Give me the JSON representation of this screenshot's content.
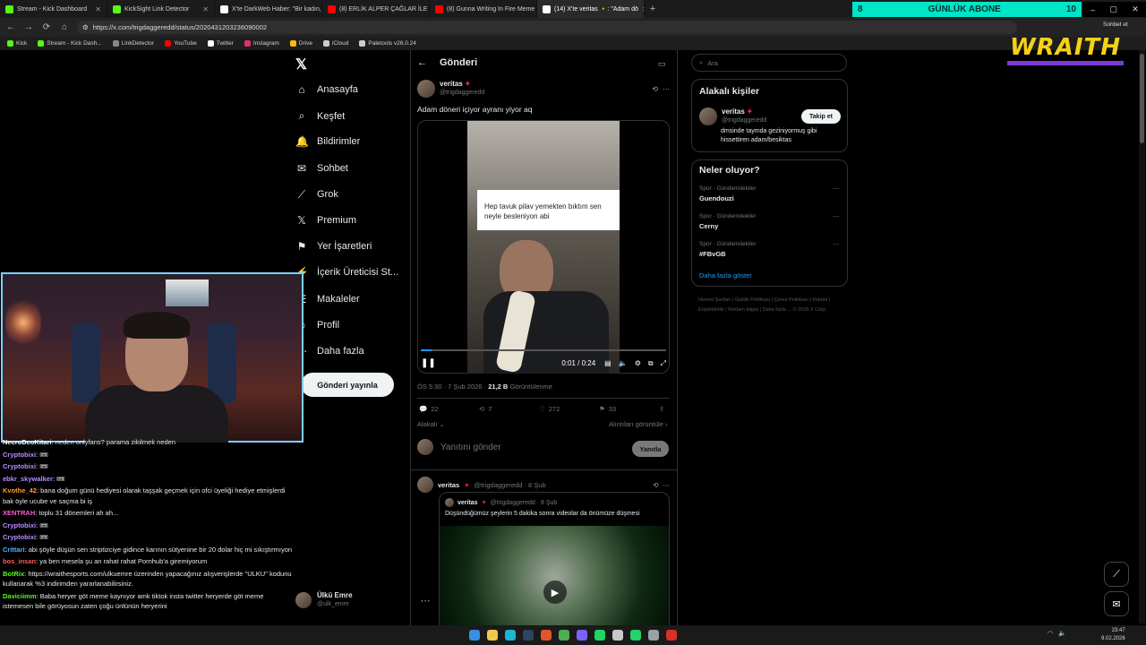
{
  "tabs": [
    {
      "title": "Stream - Kick Dashboard",
      "color": "#53fc18"
    },
    {
      "title": "KickSight Link Detector",
      "color": "#53fc18"
    },
    {
      "title": "X'te DarkWeb Haber: \"Bir kadın, G",
      "color": "#ffffff"
    },
    {
      "title": "(8) ERLİK ALPER ÇAĞLAR İLE HASB",
      "color": "#ff0000"
    },
    {
      "title": "(8) Gunna Writing In Fire Meme To",
      "color": "#ff0000"
    },
    {
      "title": "(14) X'te veritas 🔸: \"Adam dö",
      "color": "#ffffff",
      "active": true
    }
  ],
  "sub_banner": {
    "left": "8",
    "label": "GÜNLÜK ABONE",
    "right": "10"
  },
  "url": "https://x.com/trigdaggeredd/status/2020431203236090002",
  "bookmarks": [
    "Kick",
    "Stream - Kick Dash...",
    "LinkDetector",
    "YouTube",
    "Twitter",
    "Instagram",
    "Drive",
    "iCloud",
    "Paletools v26.0.24"
  ],
  "overlay": {
    "logo": "WRAITH",
    "chat_button": "Sohbet et",
    "extension_label": "Yer işaretleri klasörü tümleri"
  },
  "nav": {
    "items": [
      {
        "label": "Anasayfa",
        "icon": "⌂"
      },
      {
        "label": "Keşfet",
        "icon": "⌕"
      },
      {
        "label": "Bildirimler",
        "icon": "🔔"
      },
      {
        "label": "Sohbet",
        "icon": "✉"
      },
      {
        "label": "Grok",
        "icon": "⟋"
      },
      {
        "label": "Premium",
        "icon": "𝕏"
      },
      {
        "label": "Yer İşaretleri",
        "icon": "⚑"
      },
      {
        "label": "İçerik Üreticisi St...",
        "icon": "⚡"
      },
      {
        "label": "Makaleler",
        "icon": "☰"
      },
      {
        "label": "Profil",
        "icon": "☺"
      },
      {
        "label": "Daha fazla",
        "icon": "⋯"
      }
    ],
    "post_button": "Gönderi yayınla",
    "profile": {
      "name": "Ülkü Emre",
      "handle": "@ulk_emre"
    }
  },
  "main": {
    "header_title": "Gönderi",
    "post": {
      "author": "veritas",
      "handle": "@trigdaggeredd",
      "text": "Adam döneri içiyor ayranı yiyor aq",
      "video_caption": "Hep tavuk pilav yemekten bıktım sen neyle besleniyon abi",
      "video_time": "0:01 / 0:24",
      "time_date": "ÖS 5:30 · 7 Şub 2026 ·",
      "views": "21,2 B",
      "views_label": "Görüntülenme",
      "replies": "22",
      "reposts": "7",
      "likes": "272",
      "bookmarks": "33",
      "related": "Alakalı",
      "quotes_link": "Alıntıları görüntüle"
    },
    "reply_placeholder": "Yanıtını gönder",
    "reply_button": "Yanıtla",
    "second_post": {
      "author": "veritas",
      "handle": "@trigdaggeredd · 8 Şub",
      "quoted_author": "veritas",
      "quoted_handle": "@trigdaggeredd · 8 Şub",
      "quoted_text": "Düşündüğümüz şeylerin 5 dakika sonra videolar da önümüze düşmesi"
    }
  },
  "right": {
    "search_placeholder": "Ara",
    "related_title": "Alakalı kişiler",
    "person": {
      "name": "veritas",
      "handle": "@trigdaggeredd",
      "bio": "dmsinde taymda geziniyormuş gibi hissettiren adam/besiktas",
      "follow_label": "Takip et"
    },
    "trends_title": "Neler oluyor?",
    "trends": [
      {
        "category": "Spor · Gündemdekiler",
        "name": "Guendouzi"
      },
      {
        "category": "Spor · Gündemdekiler",
        "name": "Cerny"
      },
      {
        "category": "Spor · Gündemdekiler",
        "name": "#FBvGB"
      }
    ],
    "show_more": "Daha fazla göster",
    "footer": "Hizmet Şartları | Gizlilik Politikası | Çerez Politikası | Imprint | Erişilebilirlik | Reklam bilgisi | Daha fazla ... © 2026 X Corp."
  },
  "chat": [
    {
      "name": "NecroDcoKitari",
      "color": "#ffffff",
      "text": ": neden onlyfans? parama zikilmek neden"
    },
    {
      "name": "Cryptobixi",
      "color": "#b58cff",
      "text": ": 🎟"
    },
    {
      "name": "Cryptobixi",
      "color": "#b58cff",
      "text": ": 🎟"
    },
    {
      "name": "ebkr_skywalker",
      "color": "#b58cff",
      "text": ": 🎟"
    },
    {
      "name": "Kvothe_42",
      "color": "#ff9a3c",
      "text": ": bana doğum günü hediyesi olarak taşşak geçmek için ofci üyeliği hediye etmişlerdi bak öyle ucube ve saçma bi iş"
    },
    {
      "name": "XENTRAH",
      "color": "#ff5ad1",
      "text": ": toplu 31 dönemleri ah ah..."
    },
    {
      "name": "Cryptobixi",
      "color": "#b58cff",
      "text": ": 🎟"
    },
    {
      "name": "Cryptobixi",
      "color": "#b58cff",
      "text": ": 🎟"
    },
    {
      "name": "Crittari",
      "color": "#4db8ff",
      "text": ": abi şöyle düşün sen striptizciye gidince karının sütyenine bir 20 dolar hiç mi sıkıştırmıyon"
    },
    {
      "name": "bos_insan",
      "color": "#ff5c5c",
      "text": ": ya ben mesela şu an rahat rahat Pornhub'a giremiyorum"
    },
    {
      "name": "BotRix",
      "color": "#53fc18",
      "text": ": https://wraithesports.com/ulkuemre üzerinden yapacağınız alışverişlerde \"ULKU\" kodunu kullanarak %3 indirimden yararlanabilirsiniz."
    },
    {
      "name": "Daviciimm",
      "color": "#53fc18",
      "text": ": Baba heryer göt meme kaynıyor amk tiktok insta twitter heryerde göt meme istemesen bile görüyosun zaten çoğu ünlünün heryerini"
    }
  ],
  "clock": {
    "time": "23:47",
    "date": "9.02.2026"
  }
}
